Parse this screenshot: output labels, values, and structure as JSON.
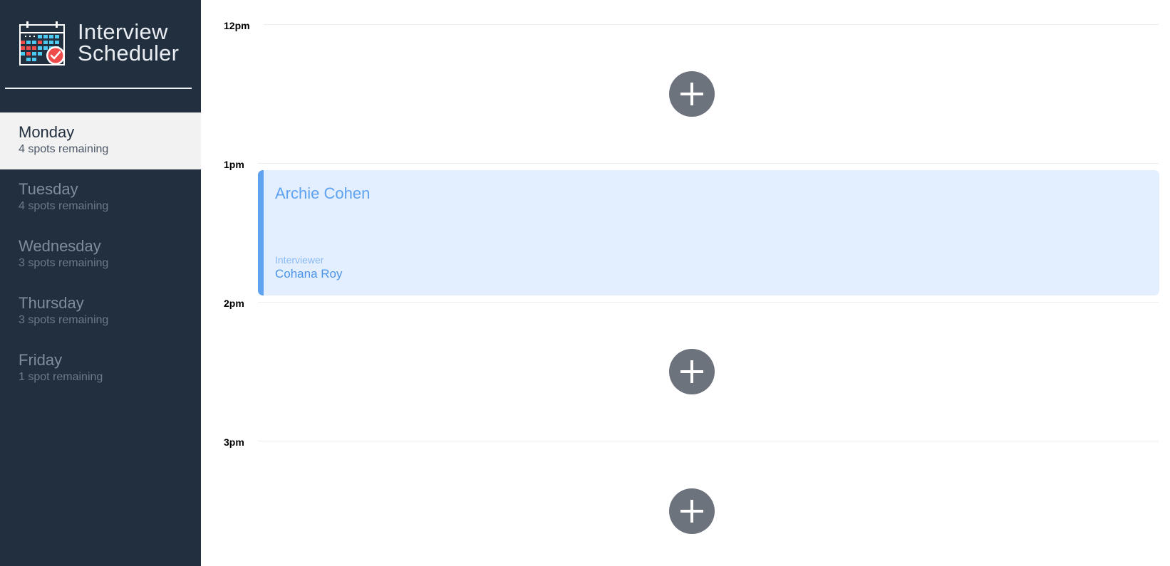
{
  "app": {
    "title_line1": "Interview",
    "title_line2": "Scheduler",
    "logo_icon": "calendar-check-icon"
  },
  "sidebar": {
    "days": [
      {
        "name": "Monday",
        "spots": "4 spots remaining",
        "selected": true
      },
      {
        "name": "Tuesday",
        "spots": "4 spots remaining",
        "selected": false
      },
      {
        "name": "Wednesday",
        "spots": "3 spots remaining",
        "selected": false
      },
      {
        "name": "Thursday",
        "spots": "3 spots remaining",
        "selected": false
      },
      {
        "name": "Friday",
        "spots": "1 spot remaining",
        "selected": false
      }
    ]
  },
  "schedule": {
    "slots": [
      {
        "time": "12pm",
        "status": "empty",
        "action_icon": "plus-icon"
      },
      {
        "time": "1pm",
        "status": "booked",
        "student": "Archie Cohen",
        "interviewer_label": "Interviewer",
        "interviewer": "Cohana Roy"
      },
      {
        "time": "2pm",
        "status": "empty",
        "action_icon": "plus-icon"
      },
      {
        "time": "3pm",
        "status": "empty",
        "action_icon": "plus-icon"
      }
    ]
  },
  "colors": {
    "sidebar_bg": "#222f3e",
    "selected_day_bg": "#f2f2f2",
    "appointment_bg": "#e3efff",
    "appointment_accent": "#5ea2f0",
    "add_button": "#6c737d"
  }
}
